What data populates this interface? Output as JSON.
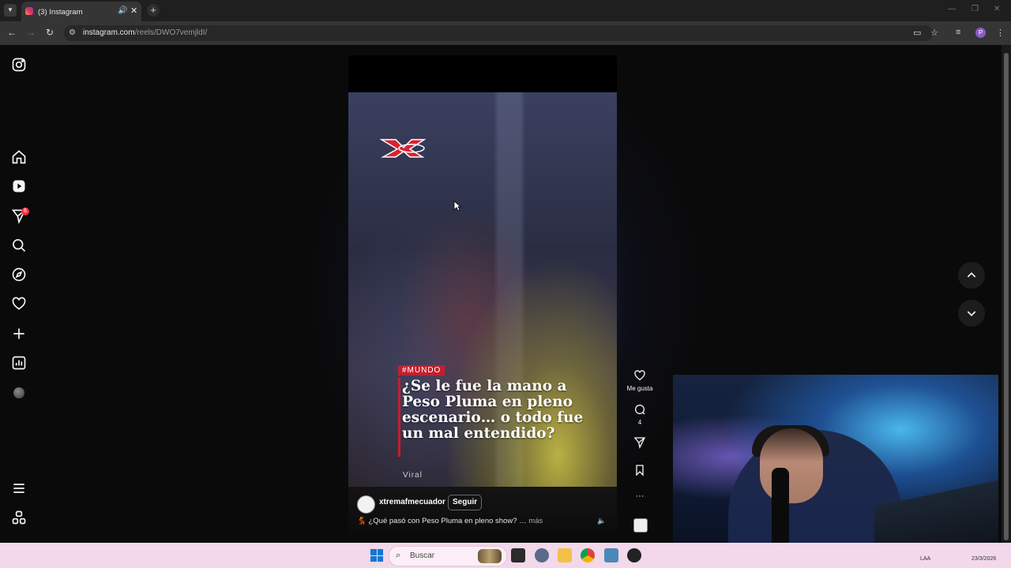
{
  "browser": {
    "tab_title": "(3) Instagram",
    "new_tab": "+",
    "url_host": "instagram.com",
    "url_path": "/reels/DWO7vemjldI/",
    "profile_initial": "P"
  },
  "sidebar": {
    "notifications_badge": "6"
  },
  "reel": {
    "tag": "#MUNDO",
    "headline": "¿Se le fue la mano a Peso Pluma en pleno escenario… o todo fue un mal entendido?",
    "viral_label": "Viral",
    "channel_name": "xtremafmecuador",
    "follow_label": "Seguir",
    "caption_emoji": "💃",
    "caption": "¿Qué pasó con Peso Pluma en pleno show? …",
    "more_label": "más"
  },
  "actions": {
    "like_label": "Me gusta",
    "comment_count": "4",
    "more_dots": "···"
  },
  "taskbar": {
    "search_placeholder": "Buscar",
    "tray_lang": "LAA",
    "tray_date": "23/3/2026"
  },
  "colors": {
    "tag_red": "#c4202c",
    "badge_red": "#ff3040",
    "taskbar_bg": "#f2d8ea"
  }
}
